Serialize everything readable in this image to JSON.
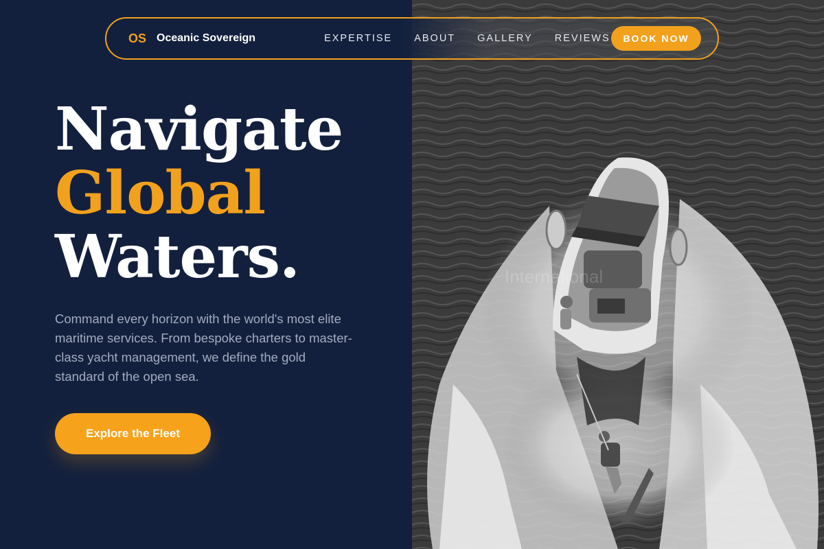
{
  "nav": {
    "brand_mark": "OS",
    "brand_name": "Oceanic Sovereign",
    "links": [
      "EXPERTISE",
      "ABOUT",
      "GALLERY",
      "REVIEWS"
    ],
    "cta_label": "BOOK NOW"
  },
  "hero": {
    "headline_line1": "Navigate",
    "headline_line2": "Global",
    "headline_line3": "Waters.",
    "description": "Command every horizon with the world's most elite maritime services. From bespoke charters to master-class yacht management, we define the gold standard of the open sea.",
    "cta_label": "Explore the Fleet",
    "image_watermark": "International"
  },
  "colors": {
    "navy_background": "#13203d",
    "accent_gold": "#f2a11d",
    "text_white": "#ffffff",
    "text_muted": "#a3abc0"
  }
}
